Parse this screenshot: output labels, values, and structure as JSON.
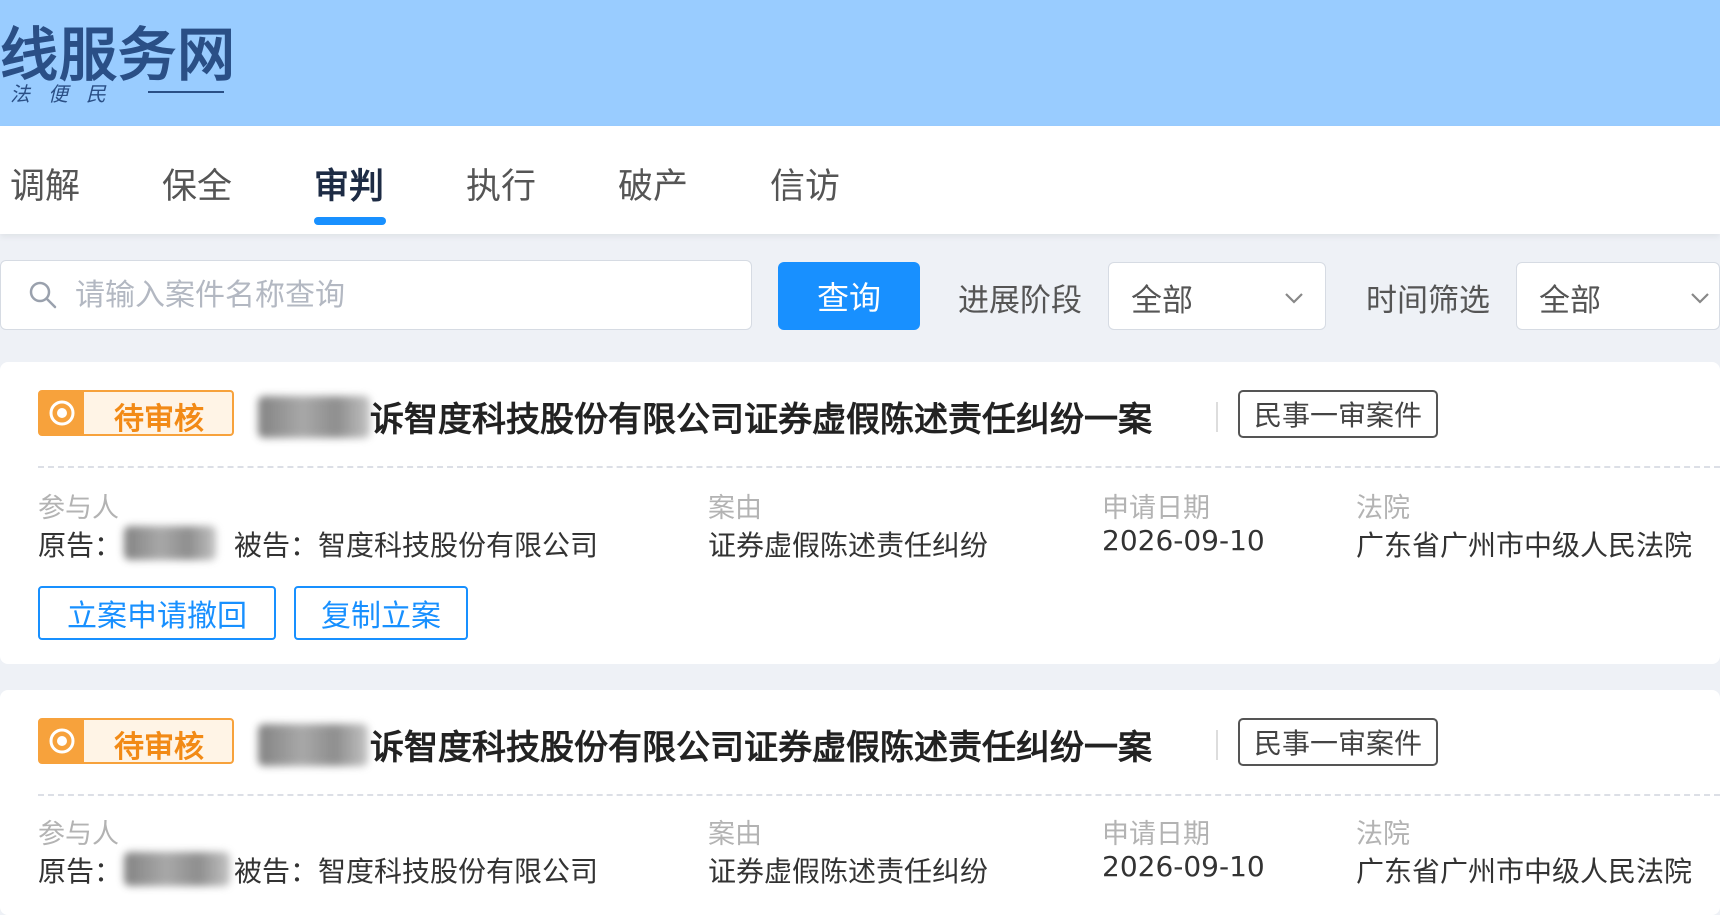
{
  "header": {
    "site_title": "线服务网",
    "slogan": "法便民"
  },
  "tabs": [
    {
      "label": "调解",
      "active": false
    },
    {
      "label": "保全",
      "active": false
    },
    {
      "label": "审判",
      "active": true
    },
    {
      "label": "执行",
      "active": false
    },
    {
      "label": "破产",
      "active": false
    },
    {
      "label": "信访",
      "active": false
    }
  ],
  "search": {
    "placeholder": "请输入案件名称查询",
    "value": "",
    "button_label": "查询"
  },
  "filters": {
    "stage_label": "进展阶段",
    "stage_value": "全部",
    "time_label": "时间筛选",
    "time_value": "全部"
  },
  "cases": [
    {
      "status": "待审核",
      "title": "诉智度科技股份有限公司证券虚假陈述责任纠纷一案",
      "tag": "民事一审案件",
      "participants_label": "参与人",
      "plaintiff_prefix": "原告：",
      "defendant_text": "被告：智度科技股份有限公司",
      "cause_label": "案由",
      "cause_value": "证券虚假陈述责任纠纷",
      "date_label": "申请日期",
      "date_value": "2026-09-10",
      "court_label": "法院",
      "court_value": "广东省广州市中级人民法院",
      "actions": [
        "立案申请撤回",
        "复制立案"
      ]
    },
    {
      "status": "待审核",
      "title": "诉智度科技股份有限公司证券虚假陈述责任纠纷一案",
      "tag": "民事一审案件",
      "participants_label": "参与人",
      "plaintiff_prefix": "原告：",
      "defendant_text": "被告：智度科技股份有限公司",
      "cause_label": "案由",
      "cause_value": "证券虚假陈述责任纠纷",
      "date_label": "申请日期",
      "date_value": "2026-09-10",
      "court_label": "法院",
      "court_value": "广东省广州市中级人民法院"
    }
  ],
  "colors": {
    "banner": "#99ccff",
    "accent": "#1890ff",
    "status_orange": "#f7a23c"
  }
}
